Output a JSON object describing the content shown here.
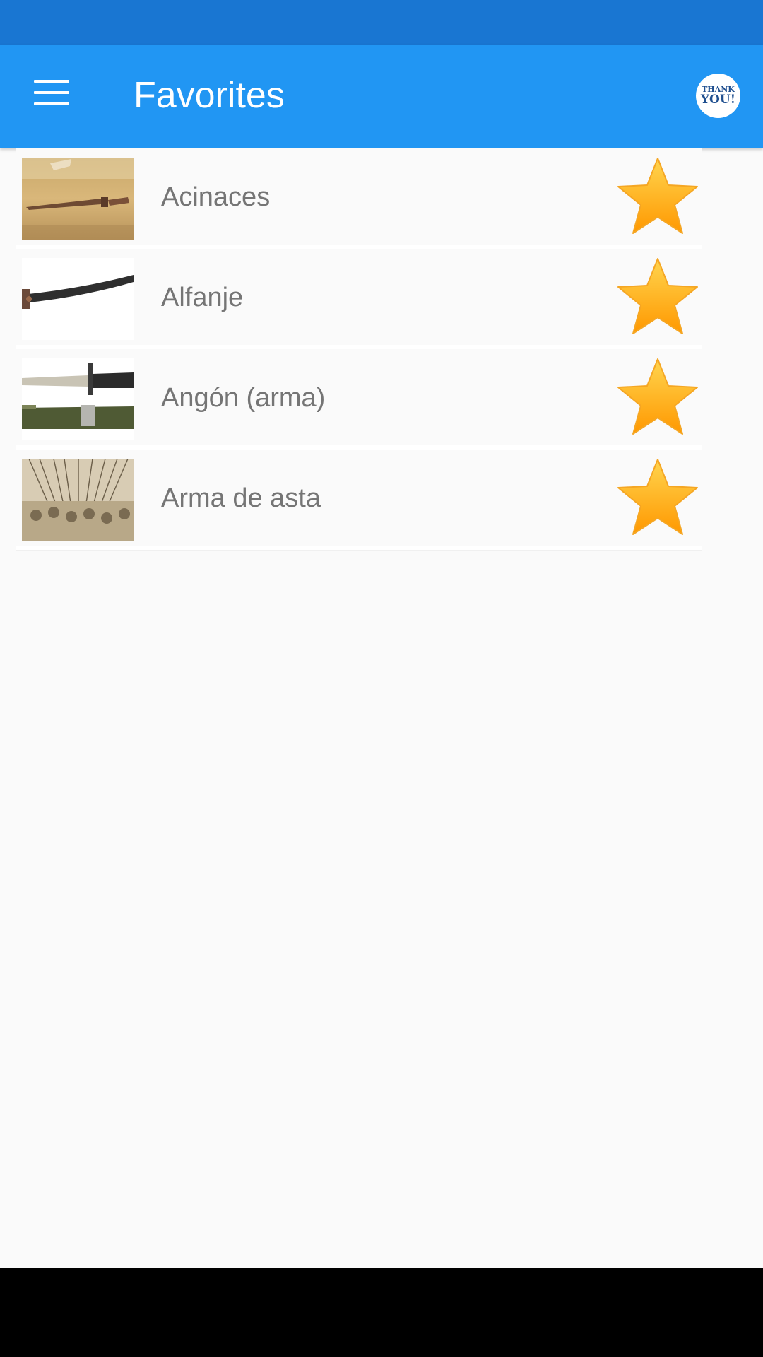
{
  "app_bar": {
    "title": "Favorites",
    "menu_icon": "hamburger-menu-icon",
    "badge": {
      "line1": "THANK",
      "line2": "YOU!"
    },
    "color": "#2196f3",
    "status_bar_color": "#1976d2"
  },
  "favorites": [
    {
      "label": "Acinaces",
      "thumbnail": "dagger-photo",
      "starred": true
    },
    {
      "label": "Alfanje",
      "thumbnail": "curved-sword-photo",
      "starred": true
    },
    {
      "label": "Angón (arma)",
      "thumbnail": "bayonet-photo",
      "starred": true
    },
    {
      "label": "Arma de asta",
      "thumbnail": "pikemen-engraving",
      "starred": true
    }
  ],
  "colors": {
    "star": "#ffa726",
    "label": "#757575",
    "background": "#fafafa"
  }
}
